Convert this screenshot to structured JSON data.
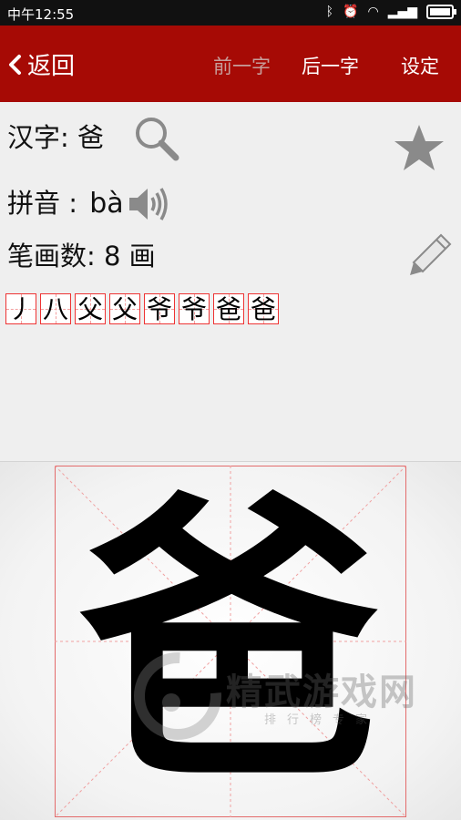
{
  "status_bar": {
    "time": "中午12:55",
    "icons": [
      "bluetooth-icon",
      "alarm-icon",
      "wifi-icon",
      "signal-icon",
      "battery-icon"
    ]
  },
  "title_bar": {
    "back_label": "返回",
    "prev_label": "前一字",
    "next_label": "后一字",
    "settings_label": "设定",
    "color": "#a60a05",
    "prev_disabled_color": "#c79e9b"
  },
  "info": {
    "hanzi_label": "汉字:",
    "hanzi_value": "爸",
    "pinyin_label": "拼音 :",
    "pinyin_value": "bà",
    "strokes_label": "笔画数:",
    "strokes_value": "8",
    "strokes_unit": "画"
  },
  "stroke_sequence": [
    "丿",
    "八",
    "父",
    "父",
    "爷",
    "爷",
    "爸",
    "爸"
  ],
  "display": {
    "character": "爸"
  },
  "watermark": {
    "title": "精武游戏网",
    "subtitle": "排行榜专家"
  }
}
